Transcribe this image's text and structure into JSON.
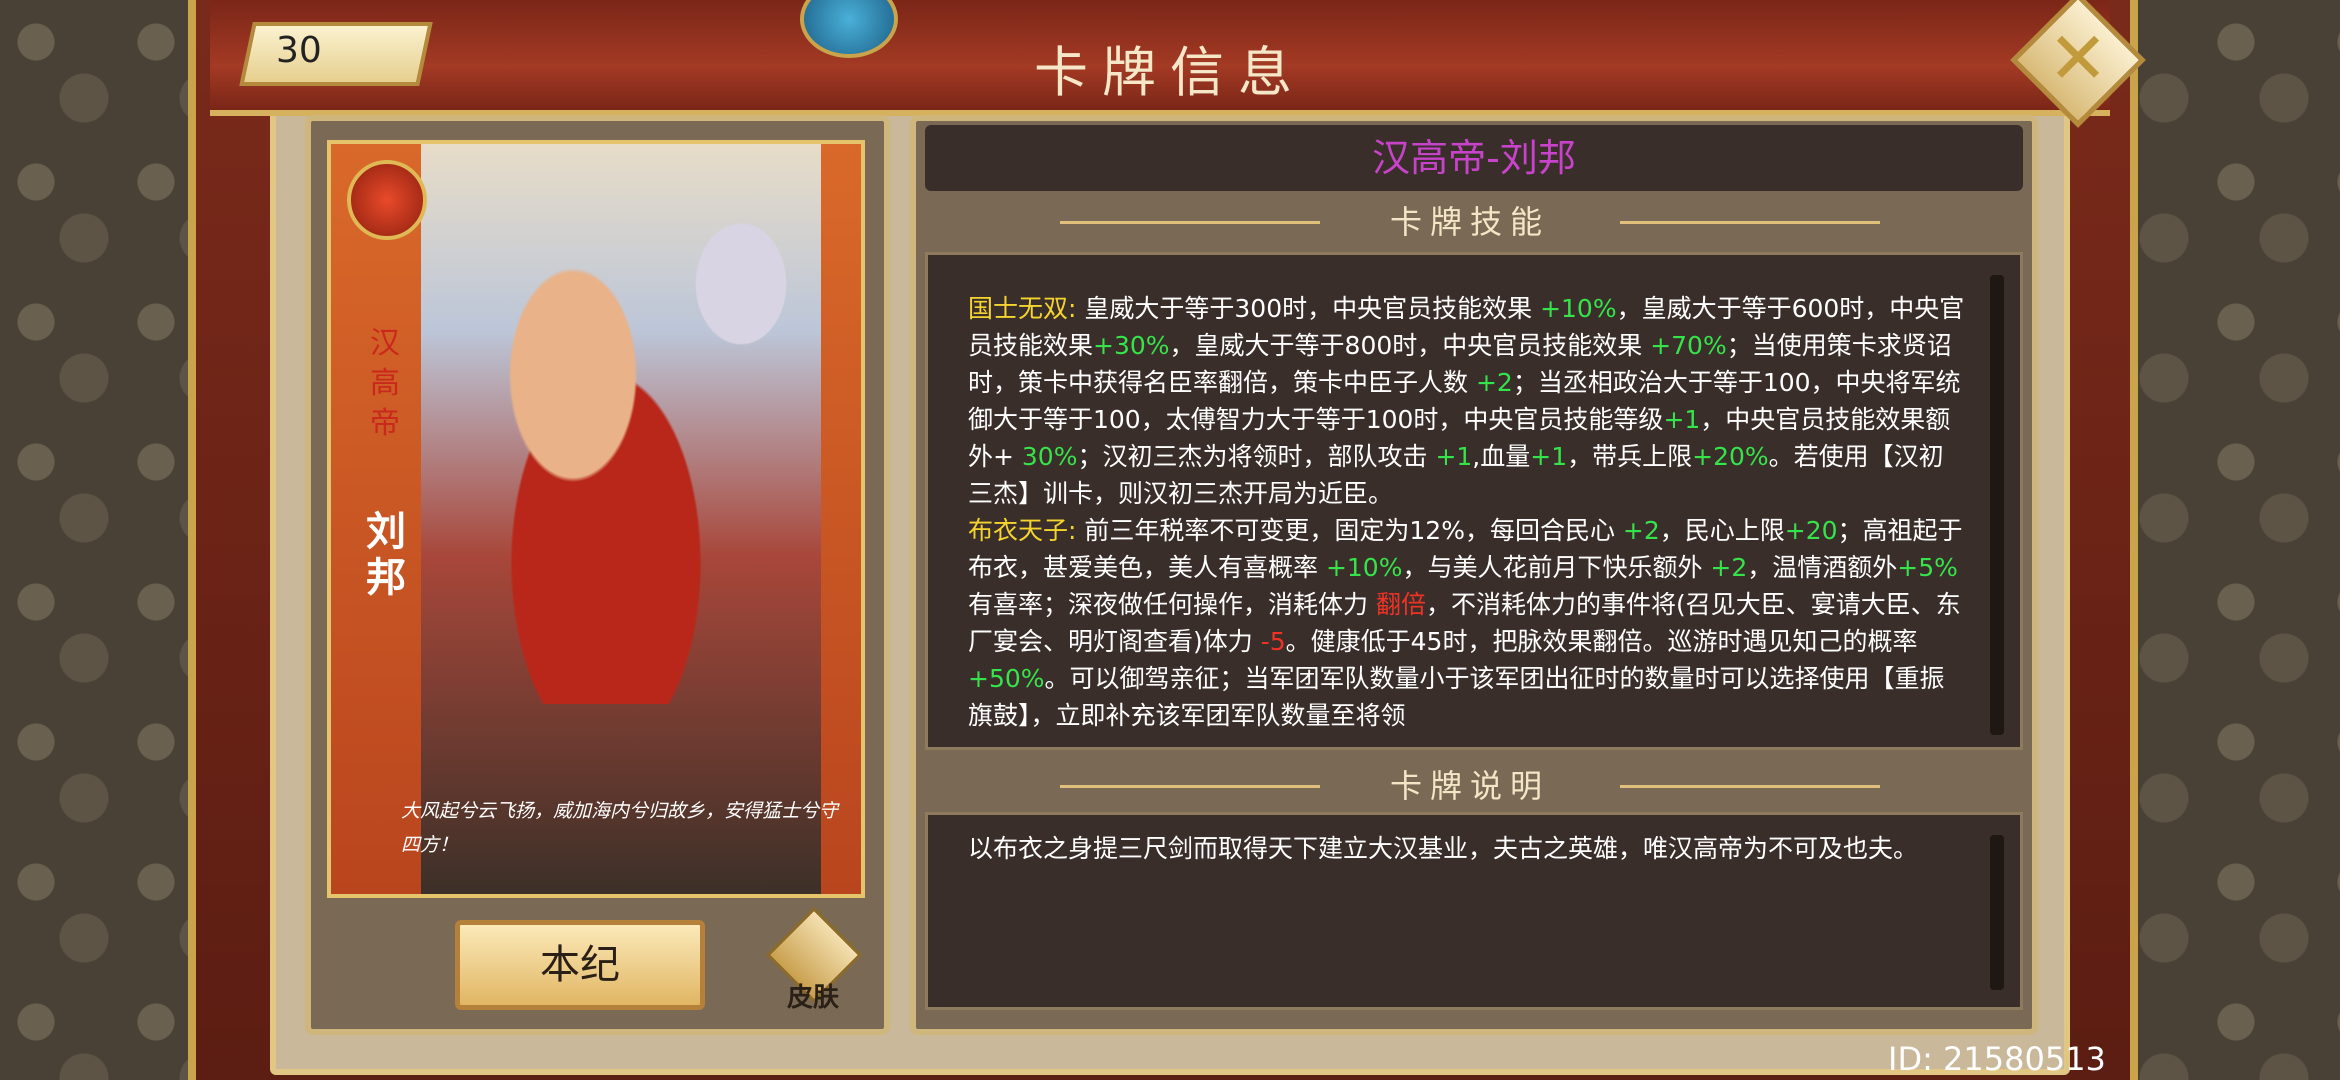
{
  "header": {
    "title": "卡牌信息",
    "level": "30"
  },
  "card": {
    "vertical_title": "汉高帝",
    "name": "刘邦",
    "poem": "大风起兮云飞扬，威加海内兮归故乡，安得猛士兮守四方！"
  },
  "buttons": {
    "benji": "本纪",
    "skin": "皮肤"
  },
  "hero": {
    "display_name": "汉高帝-刘邦"
  },
  "sections": {
    "skills": "卡牌技能",
    "description": "卡牌说明"
  },
  "skills": {
    "s1_name": "国士无双:",
    "s1_a": " 皇威大于等于300时，中央官员技能效果 ",
    "s1_b": "+10%",
    "s1_c": "，皇威大于等于600时，中央官员技能效果",
    "s1_d": "+30%",
    "s1_e": "，皇威大于等于800时，中央官员技能效果 ",
    "s1_f": "+70%",
    "s1_g": "；当使用策卡求贤诏时，策卡中获得名臣率翻倍，策卡中臣子人数 ",
    "s1_h": "+2",
    "s1_i": "；当丞相政治大于等于100，中央将军统御大于等于100，太傅智力大于等于100时，中央官员技能等级",
    "s1_j": "+1",
    "s1_k": "，中央官员技能效果额外+ ",
    "s1_l": "30%",
    "s1_m": "；汉初三杰为将领时，部队攻击 ",
    "s1_n": "+1",
    "s1_o": ",血量",
    "s1_p": "+1",
    "s1_q": "，带兵上限",
    "s1_r": "+20%",
    "s1_s": "。若使用【汉初三杰】训卡，则汉初三杰开局为近臣。",
    "s2_name": "布衣天子:",
    "s2_a": " 前三年税率不可变更，固定为12%，每回合民心 ",
    "s2_b": "+2",
    "s2_c": "，民心上限",
    "s2_d": "+20",
    "s2_e": "；高祖起于布衣，甚爱美色，美人有喜概率 ",
    "s2_f": "+10%",
    "s2_g": "，与美人花前月下快乐额外 ",
    "s2_h": "+2",
    "s2_i": "，温情酒额外",
    "s2_j": "+5%",
    "s2_k": "有喜率；深夜做任何操作，消耗体力 ",
    "s2_l": "翻倍",
    "s2_m": "，不消耗体力的事件将(召见大臣、宴请大臣、东厂宴会、明灯阁查看)体力 ",
    "s2_n": "-5",
    "s2_o": "。健康低于45时，把脉效果翻倍。巡游时遇见知己的概率 ",
    "s2_p": "+50%",
    "s2_q": "。可以御驾亲征；当军团军队数量小于该军团出征时的数量时可以选择使用【重振旗鼓】，立即补充该军团军队数量至将领"
  },
  "description": {
    "text": "以布衣之身提三尺剑而取得天下建立大汉基业，夫古之英雄，唯汉高帝为不可及也夫。"
  },
  "footer": {
    "id": "ID: 21580513"
  },
  "colors": {
    "highlight_yellow": "#f5d430",
    "bonus_green": "#35e34a",
    "penalty_red": "#ee3325",
    "name_magenta": "#c743c9"
  }
}
